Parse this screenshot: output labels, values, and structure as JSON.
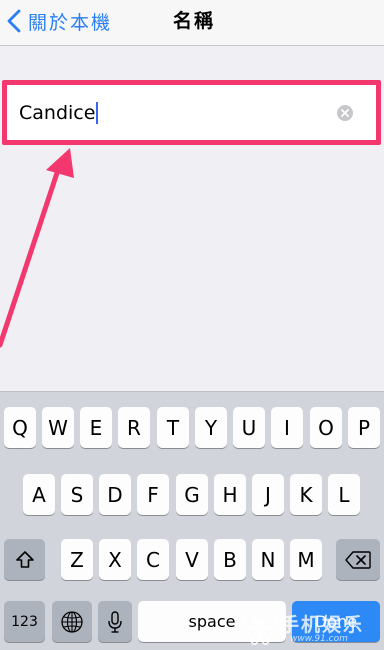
{
  "nav": {
    "back_label": "關於本機",
    "title": "名稱"
  },
  "name_field": {
    "value": "Candice"
  },
  "annotation": {
    "color": "#f2386f"
  },
  "keyboard": {
    "row1": [
      "Q",
      "W",
      "E",
      "R",
      "T",
      "Y",
      "U",
      "I",
      "O",
      "P"
    ],
    "row2": [
      "A",
      "S",
      "D",
      "F",
      "G",
      "H",
      "J",
      "K",
      "L"
    ],
    "row3": [
      "Z",
      "X",
      "C",
      "V",
      "B",
      "N",
      "M"
    ],
    "numbers_label": "123",
    "space_label": "space",
    "done_label": "Done",
    "shift_icon": "shift-arrow-icon",
    "delete_icon": "backspace-icon",
    "globe_icon": "globe-icon",
    "mic_icon": "microphone-icon"
  },
  "watermark": {
    "text": "手机娱乐",
    "sub": "www.91.com"
  },
  "colors": {
    "accent": "#2a7ff6",
    "done": "#2d89f6",
    "highlight": "#f2386f"
  }
}
